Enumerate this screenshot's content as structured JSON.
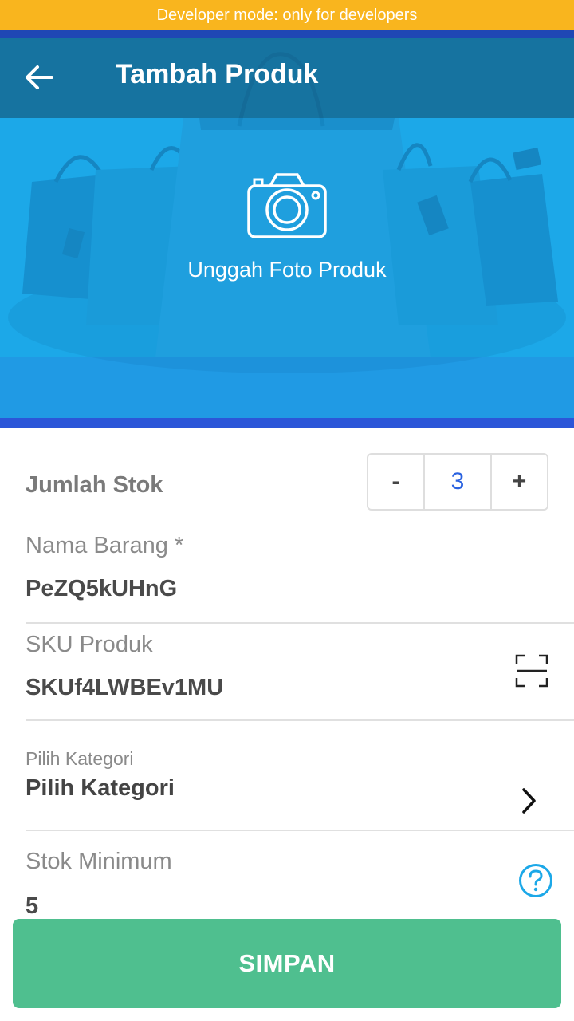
{
  "dev_banner": {
    "text": "Developer mode: only for developers"
  },
  "appbar": {
    "title": "Tambah Produk",
    "back_icon": "arrow-left-icon"
  },
  "upload": {
    "label": "Unggah Foto Produk",
    "icon": "camera-icon"
  },
  "stock": {
    "label": "Jumlah Stok",
    "decrement": "-",
    "value": "3",
    "increment": "+"
  },
  "fields": {
    "name": {
      "label": "Nama Barang *",
      "value": "PeZQ5kUHnG"
    },
    "sku": {
      "label": "SKU Produk",
      "value": "SKUf4LWBEv1MU",
      "icon": "barcode-scan-icon"
    },
    "category": {
      "label": "Pilih Kategori",
      "value": "Pilih Kategori",
      "icon": "chevron-right-icon"
    },
    "min_stock": {
      "label": "Stok Minimum",
      "value": "5",
      "icon": "help-icon"
    }
  },
  "save": {
    "label": "SIMPAN"
  },
  "colors": {
    "banner": "#f9b51e",
    "hero": "#1ca8e8",
    "appbar": "#14648c",
    "accent": "#2a62e0",
    "save": "#4fbf8f",
    "help": "#1ca8e8"
  }
}
